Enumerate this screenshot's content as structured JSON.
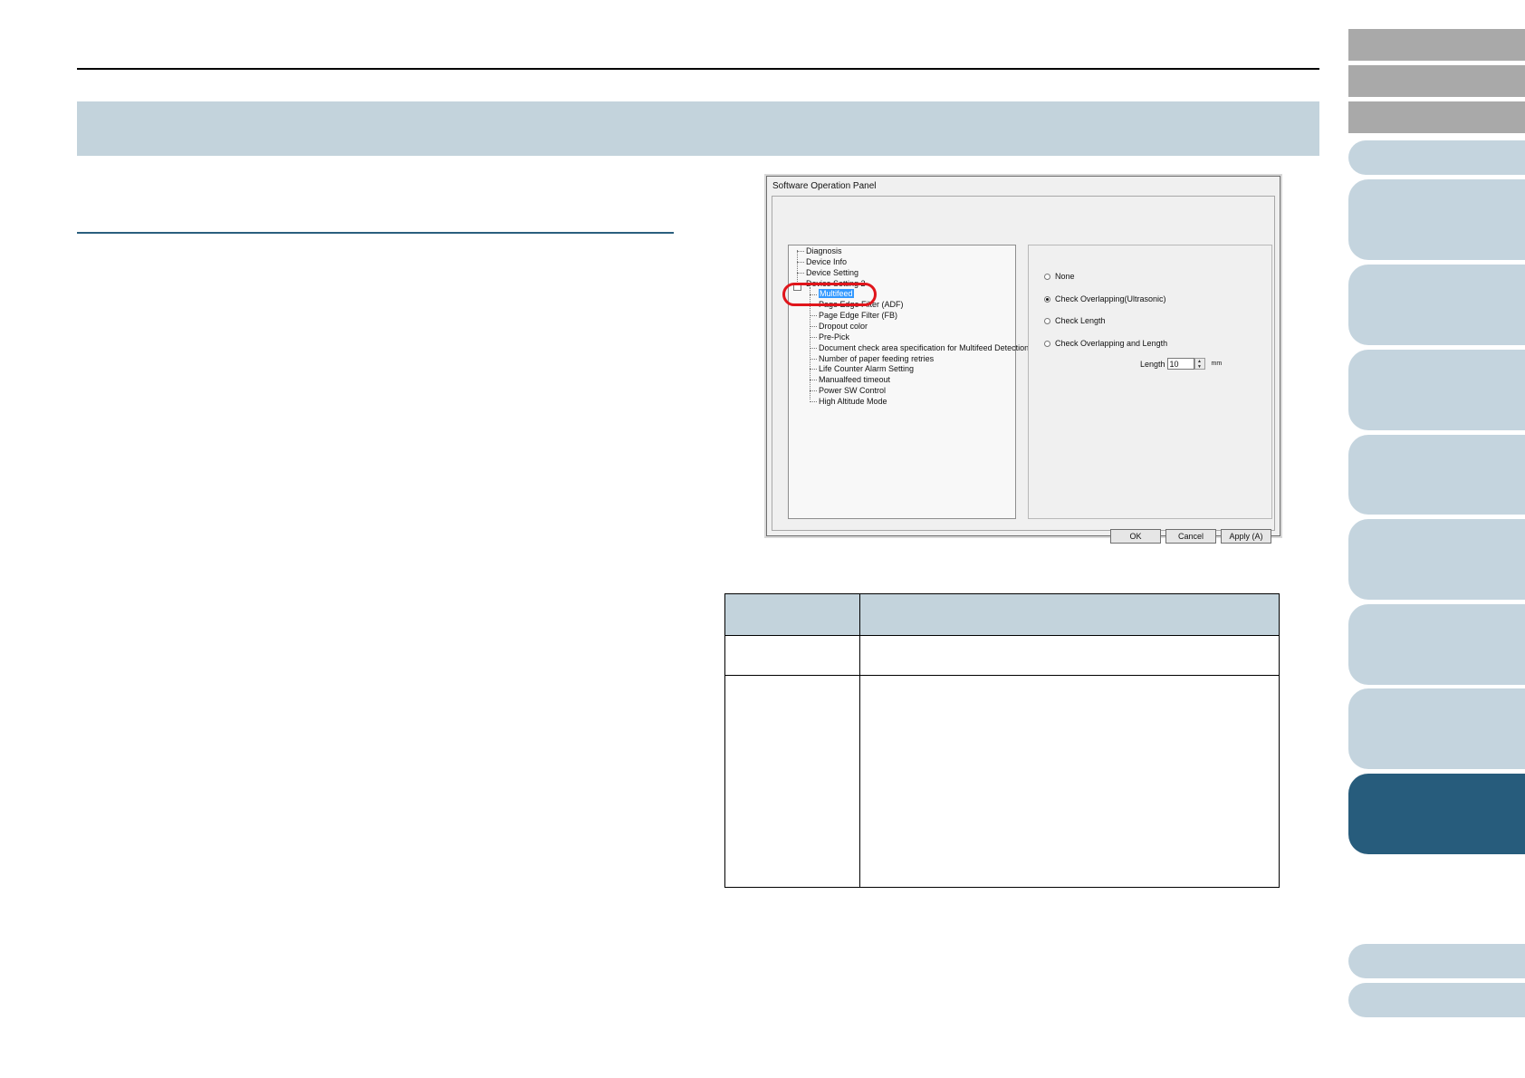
{
  "dialog": {
    "title": "Software Operation Panel",
    "tree": [
      {
        "label": "Diagnosis",
        "level": 0
      },
      {
        "label": "Device Info",
        "level": 0
      },
      {
        "label": "Device Setting",
        "level": 0
      },
      {
        "label": "Device Setting 2",
        "level": 0,
        "expanded": true
      },
      {
        "label": "Multifeed",
        "level": 1,
        "selected": true
      },
      {
        "label": "Page Edge Filter (ADF)",
        "level": 1
      },
      {
        "label": "Page Edge Filter (FB)",
        "level": 1
      },
      {
        "label": "Dropout color",
        "level": 1
      },
      {
        "label": "Pre-Pick",
        "level": 1
      },
      {
        "label": "Document check area specification for Multifeed Detection",
        "level": 1
      },
      {
        "label": "Number of paper feeding retries",
        "level": 1
      },
      {
        "label": "Life Counter Alarm Setting",
        "level": 1
      },
      {
        "label": "Manualfeed timeout",
        "level": 1
      },
      {
        "label": "Power SW Control",
        "level": 1
      },
      {
        "label": "High Altitude Mode",
        "level": 1
      }
    ],
    "options": [
      {
        "label": "None",
        "checked": false
      },
      {
        "label": "Check Overlapping(Ultrasonic)",
        "checked": true
      },
      {
        "label": "Check Length",
        "checked": false
      },
      {
        "label": "Check Overlapping and Length",
        "checked": false
      }
    ],
    "length": {
      "label": "Length",
      "value": "10",
      "unit": "mm"
    },
    "buttons": {
      "ok": "OK",
      "cancel": "Cancel",
      "apply": "Apply (A)"
    }
  },
  "colors": {
    "band": "#c3d3dc",
    "tab_active": "#275c7c",
    "tab_inactive": "#c4d4de",
    "tab_gray": "#a9a9a9",
    "highlight": "#e0151b",
    "selection": "#3399ff"
  }
}
